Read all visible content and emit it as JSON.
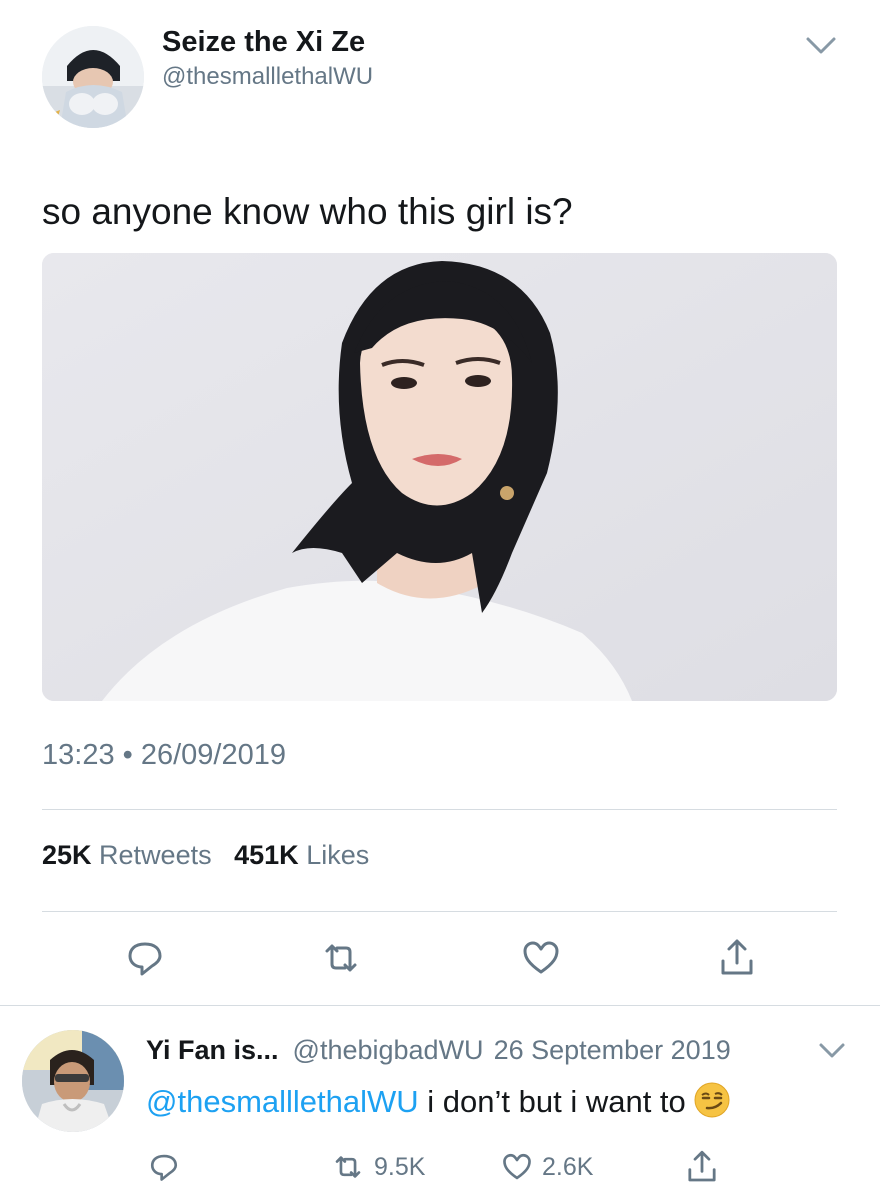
{
  "tweet": {
    "display_name": "Seize the Xi Ze",
    "handle": "@thesmalllethalWU",
    "text": "so anyone know who this girl is?",
    "timestamp": "13:23 • 26/09/2019",
    "retweets_count": "25K",
    "retweets_label": "Retweets",
    "likes_count": "451K",
    "likes_label": "Likes"
  },
  "reply": {
    "display_name": "Yi Fan is...",
    "handle": "@thebigbadWU",
    "date": "26 September 2019",
    "mention": "@thesmalllethalWU",
    "text": " i don’t but i want to",
    "emoji": "smirking-face",
    "retweets_count": "9.5K",
    "likes_count": "2.6K"
  },
  "colors": {
    "text": "#14171a",
    "secondary": "#657786",
    "accent": "#1da1f2",
    "divider": "#d6dce1"
  }
}
